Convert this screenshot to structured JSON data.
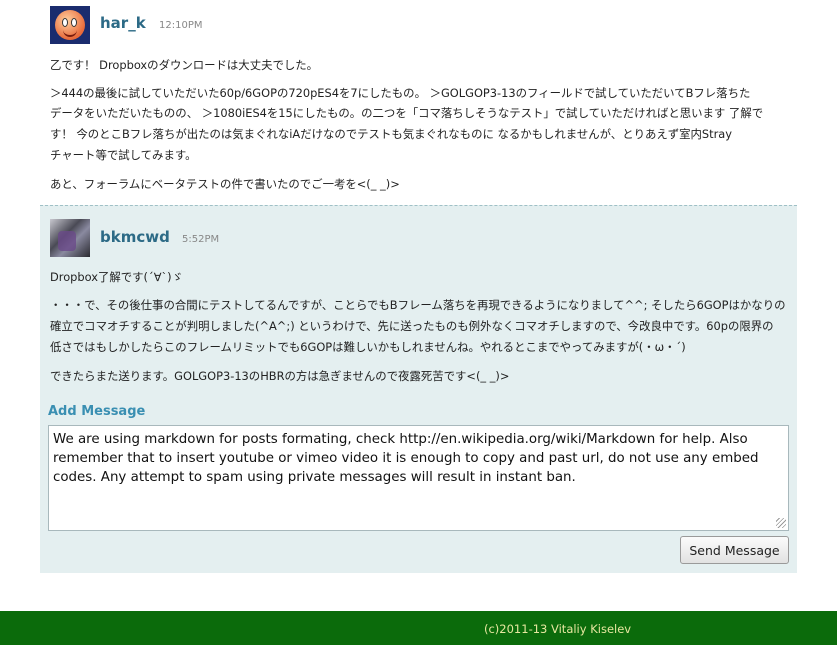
{
  "messages": [
    {
      "user": "har_k",
      "time": "12:10PM",
      "paragraphs": [
        "乙です！ Dropboxのダウンロードは大丈夫でした。",
        "＞444の最後に試していただいた60p/6GOPの720pES4を7にしたもの。 ＞GOLGOP3-13のフィールドで試していただいてBフレ落ちた",
        "データをいただいたものの、 ＞1080iES4を15にしたもの。の二つを「コマ落ちしそうなテスト」で試していただければと思います 了解で",
        "す！ 今のとこBフレ落ちが出たのは気まぐれなiAだけなのでテストも気まぐれなものに なるかもしれませんが、とりあえず室内Stray",
        "チャート等で試してみます。",
        "あと、フォーラムにベータテストの件で書いたのでご一考を<(_ _)>"
      ]
    },
    {
      "user": "bkmcwd",
      "time": "5:52PM",
      "paragraphs": [
        "Dropbox了解です(´∀`)ゞ",
        "・・・で、その後仕事の合間にテストしてるんですが、ことらでもBフレーム落ちを再現できるようになりまして^^; そしたら6GOPはかなりの",
        "確立でコマオチすることが判明しました(^A^;) というわけで、先に送ったものも例外なくコマオチしますので、今改良中です。60pの限界の",
        "低さではもしかしたらこのフレームリミットでも6GOPは難しいかもしれませんね。やれるとこまでやってみますが(・ω・´)",
        "できたらまた送ります。GOLGOP3-13のHBRの方は急ぎませんので夜露死苦です<(_ _)>"
      ]
    }
  ],
  "add_message": {
    "title": "Add Message",
    "text": "We are using markdown for posts formating, check http://en.wikipedia.org/wiki/Markdown for help. Also remember that to insert youtube or vimeo video it is enough to copy and past url, do not use any embed codes. Any attempt to spam using private messages will result in instant ban.",
    "send_label": "Send Message"
  },
  "footer": {
    "copyright": "(c)2011-13 Vitaliy Kiselev"
  },
  "colors": {
    "username": "#2c6a86",
    "panel": "#e4eff0",
    "footer": "#0b6b0b"
  }
}
